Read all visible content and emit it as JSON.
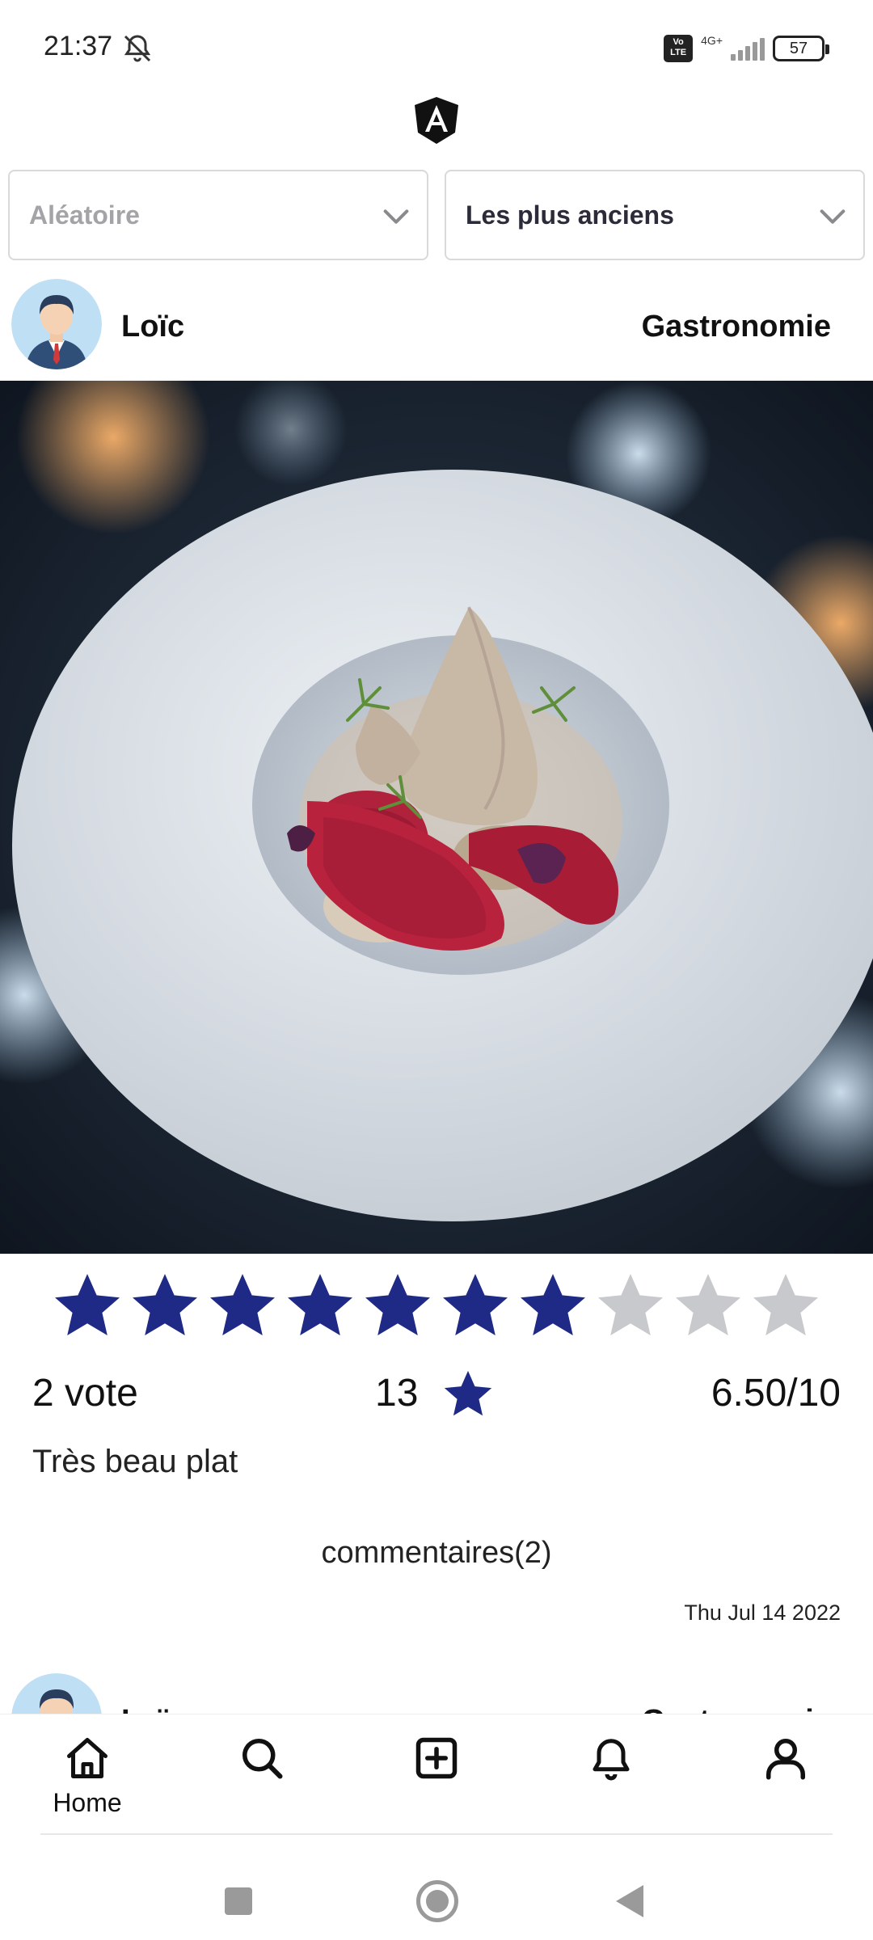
{
  "status_bar": {
    "time": "21:37",
    "mute_icon": "bell-off-icon",
    "volte_label": "Vo LTE",
    "network": "4G+",
    "battery": "57"
  },
  "filters": {
    "order_select": "Aléatoire",
    "sort_select": "Les plus anciens"
  },
  "post": {
    "author": "Loïc",
    "category": "Gastronomie",
    "rating": {
      "filled": 7,
      "total": 10
    },
    "votes": "2 vote",
    "star_count": "13",
    "score": "6.50/10",
    "description": "Très beau plat",
    "comments": "commentaires(2)",
    "date": "Thu Jul 14 2022"
  },
  "next_post": {
    "author": "Loïc",
    "category": "Gastronomie"
  },
  "bottom_nav": {
    "items": [
      {
        "icon": "home-icon",
        "label": "Home"
      },
      {
        "icon": "search-icon",
        "label": ""
      },
      {
        "icon": "add-square-icon",
        "label": ""
      },
      {
        "icon": "bell-icon",
        "label": ""
      },
      {
        "icon": "profile-icon",
        "label": ""
      }
    ]
  },
  "colors": {
    "star_filled": "#1e2a85",
    "star_empty": "#c7c9cc",
    "text": "#111111"
  }
}
